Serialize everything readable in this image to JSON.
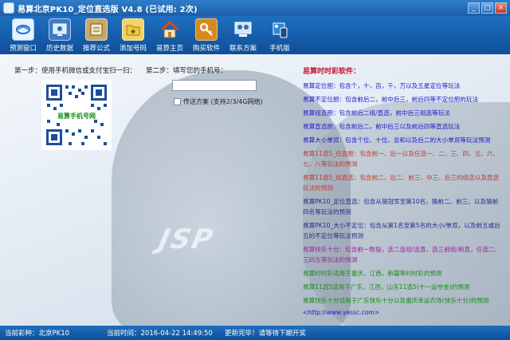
{
  "window": {
    "title": "易算北京PK10_定位直选版 V4.8 (已试用: 2次)",
    "buttons": [
      "_",
      "□",
      "×"
    ]
  },
  "toolbar": {
    "items": [
      {
        "label": "预测窗口",
        "icon": "forecast-window-icon"
      },
      {
        "label": "历史数据",
        "icon": "history-data-icon"
      },
      {
        "label": "推荐公式",
        "icon": "recommend-formula-icon"
      },
      {
        "label": "添加号码",
        "icon": "add-numbers-icon"
      },
      {
        "label": "易算主页",
        "icon": "home-icon"
      },
      {
        "label": "购买软件",
        "icon": "key-icon"
      },
      {
        "label": "联系方案",
        "icon": "contact-icon"
      },
      {
        "label": "手机版",
        "icon": "mobile-icon"
      }
    ]
  },
  "steps": {
    "step1": "第一步：使用手机微信或支付宝扫一扫：",
    "step2": "第二步：填写您的手机号：",
    "qr_caption": "易算手机号网"
  },
  "phone": {
    "value": "",
    "placeholder": ""
  },
  "send_option": {
    "label": "传送方案 (支持2/3/4G网络)",
    "checked": false
  },
  "info": {
    "title": "易算时时彩软件：",
    "items": [
      {
        "text": "易算定位胆：包含个，十，百，千，万以及五星定位等玩法",
        "color": "blue"
      },
      {
        "text": "易算不定位胆：包含前后二，前中后三，前后四等不定位胆的玩法",
        "color": "blue"
      },
      {
        "text": "易算组选胆：包含前后二组/直选，前中后三组选等玩法",
        "color": "blue"
      },
      {
        "text": "易算直选胆：包含前后二，前中后三以及前后四等直选玩法",
        "color": "blue"
      },
      {
        "text": "易算大小单双：包含个位、十位、总和以及后二的大小单双等玩法预测",
        "color": "blue"
      },
      {
        "text": "易算11选5_任选胆：包含前一、后一以及任选一、二、三、四、五、六、七、八等玩法的预测",
        "color": "red"
      },
      {
        "text": "易算11选5_组直选：包含前二、后二、前三、中三、后三的组选以及直选玩法的预测",
        "color": "red"
      },
      {
        "text": "易算PK10_定位直选：包含从猜冠军至第10名，猜前二、前三、以及猜前四名等玩法的预测",
        "color": "navy"
      },
      {
        "text": "易算PK10_大小不定位：包含从第1名至第5名的大小/单双，以及前五或后五的不定位等玩法预测",
        "color": "navy"
      },
      {
        "text": "易算快乐十分：包含前一数投，选二连组/连直，选三前组/前直，任选二、三四五等玩法的预测",
        "color": "purple"
      },
      {
        "text": "易算时时彩适用于重庆，江西，新疆等时时彩的预测",
        "color": "green"
      },
      {
        "text": "易算11选5适用于广东，江西，山东11选5(十一运夺金)的预测",
        "color": "green"
      },
      {
        "text": "易算快乐十分适用于广东快乐十分以及重庆幸运农场(快乐十分)的预测",
        "color": "green"
      }
    ],
    "link": "<http://www.yessc.com>"
  },
  "statusbar": {
    "lottery": "当前彩种：北京PK10",
    "time": "当前时间：2016-04-22 14:49:50",
    "status": "更新完毕！请等待下期开奖"
  }
}
